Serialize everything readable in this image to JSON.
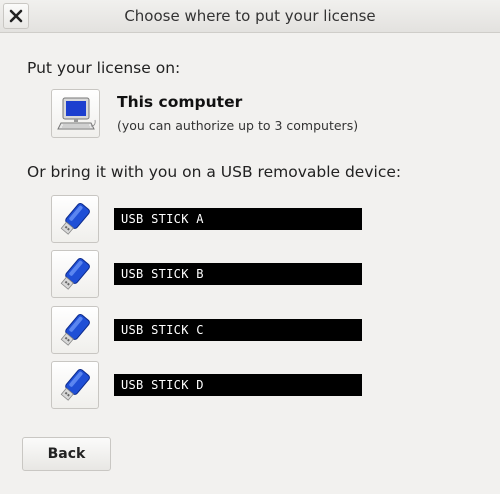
{
  "window": {
    "title": "Choose where to put your license",
    "close_icon": "close-icon"
  },
  "computer_section": {
    "heading": "Put your license on:",
    "option_title": "This computer",
    "option_subtitle": "(you can authorize up to 3 computers)",
    "icon": "computer-icon"
  },
  "usb_section": {
    "heading": "Or bring it with you on a USB removable device:",
    "icon": "usb-stick-icon",
    "devices": [
      {
        "name": "USB STICK A"
      },
      {
        "name": "USB STICK B"
      },
      {
        "name": "USB STICK C"
      },
      {
        "name": "USB STICK D"
      }
    ]
  },
  "footer": {
    "back_label": "Back"
  },
  "colors": {
    "background": "#f2f1ef",
    "device_bar": "#000000",
    "usb_blue": "#1f4fd6"
  }
}
